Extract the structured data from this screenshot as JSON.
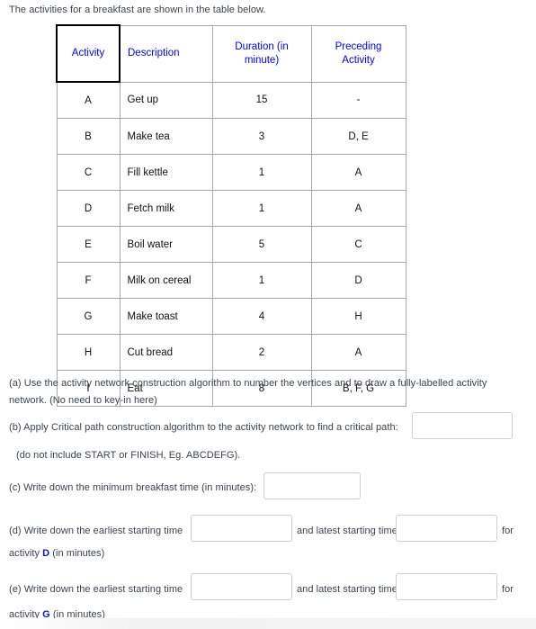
{
  "intro": "The activities for a breakfast are shown in the table below.",
  "table": {
    "headers": {
      "activity": "Activity",
      "description": "Description",
      "duration": "Duration (in minute)",
      "preceding": "Preceding Activity"
    },
    "header_color": "#0000FF",
    "rows": [
      {
        "activity": "A",
        "description": "Get up",
        "duration": "15",
        "preceding": "-"
      },
      {
        "activity": "B",
        "description": "Make tea",
        "duration": "3",
        "preceding": "D, E"
      },
      {
        "activity": "C",
        "description": "Fill kettle",
        "duration": "1",
        "preceding": "A"
      },
      {
        "activity": "D",
        "description": "Fetch milk",
        "duration": "1",
        "preceding": "A"
      },
      {
        "activity": "E",
        "description": "Boil water",
        "duration": "5",
        "preceding": "C"
      },
      {
        "activity": "F",
        "description": "Milk on cereal",
        "duration": "1",
        "preceding": "D"
      },
      {
        "activity": "G",
        "description": "Make toast",
        "duration": "4",
        "preceding": "H"
      },
      {
        "activity": "H",
        "description": "Cut bread",
        "duration": "2",
        "preceding": "A"
      },
      {
        "activity": "I",
        "description": "Eat",
        "duration": "8",
        "preceding": "B, F, G"
      }
    ]
  },
  "questions": {
    "a": "(a) Use the activity network construction algorithm to number the vertices and to draw a fully-labelled activity network. (No need to key-in here)",
    "b": "(b) Apply Critical path construction algorithm to the activity network to find a critical path:",
    "b_note": "(do not include START or FINISH, Eg. ABCDEFG).",
    "c": "(c) Write down the minimum breakfast time (in minutes):",
    "d_lead": "(d) Write down the earliest starting time",
    "d_mid": "and latest starting time",
    "d_for": "for",
    "d_tail_prefix": "activity",
    "d_activity_letter": "D",
    "d_tail_suffix": "(in minutes)",
    "e_lead": "(e) Write down the earliest starting time",
    "e_mid": "and latest starting time",
    "e_for": "for",
    "e_tail_prefix": "activity",
    "e_activity_letter": "G",
    "e_tail_suffix": "(in minutes)"
  },
  "inputs": {
    "b_value": "",
    "c_value": "",
    "d_earliest": "",
    "d_latest": "",
    "e_earliest": "",
    "e_latest": ""
  }
}
